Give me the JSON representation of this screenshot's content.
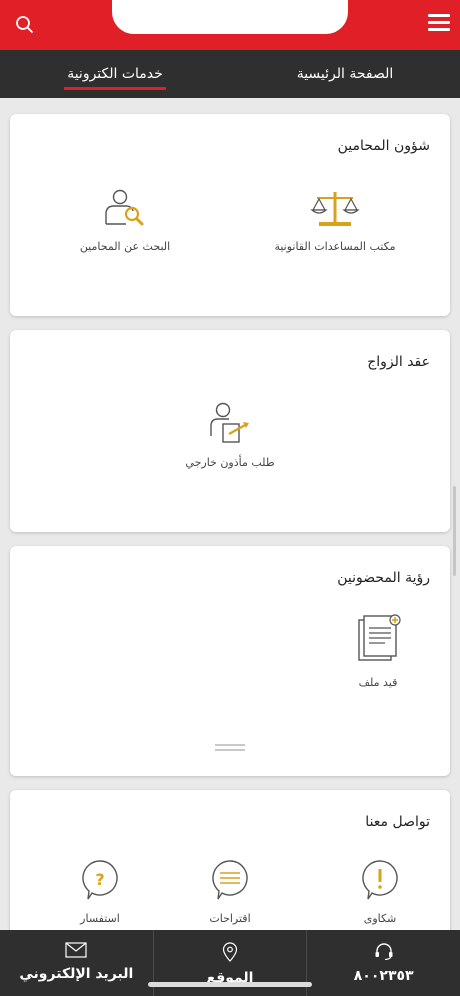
{
  "tabs": [
    {
      "label": "الصفحة الرئيسية",
      "active": false
    },
    {
      "label": "خدمات الكترونية",
      "active": true
    }
  ],
  "sections": [
    {
      "title": "شؤون المحامين",
      "items": [
        {
          "label": "مكتب المساعدات القانونية",
          "icon": "scales-icon"
        },
        {
          "label": "البحث عن المحامين",
          "icon": "person-search-icon"
        }
      ]
    },
    {
      "title": "عقد الزواج",
      "items": [
        {
          "label": "طلب مأذون خارجي",
          "icon": "person-document-icon"
        }
      ]
    },
    {
      "title": "رؤية المحضونين",
      "items": [
        {
          "label": "قيد ملف",
          "icon": "file-add-icon"
        }
      ]
    },
    {
      "title": "تواصل معنا",
      "items": [
        {
          "label": "شكاوى",
          "icon": "exclamation-bubble-icon"
        },
        {
          "label": "اقتراحات",
          "icon": "lines-bubble-icon"
        },
        {
          "label": "استفسار",
          "icon": "question-bubble-icon"
        }
      ]
    }
  ],
  "bottom_bar": [
    {
      "label": "البريد الإلكتروني",
      "icon": "mail-icon"
    },
    {
      "label": "الموقع",
      "icon": "location-pin-icon"
    },
    {
      "label": "٨٠٠٢٣٥٣",
      "icon": "headset-icon"
    }
  ],
  "colors": {
    "brand_red": "#e01f26",
    "dark_bar": "#2f2f2f",
    "icon_gold": "#d9a21b",
    "icon_gray": "#555555"
  }
}
